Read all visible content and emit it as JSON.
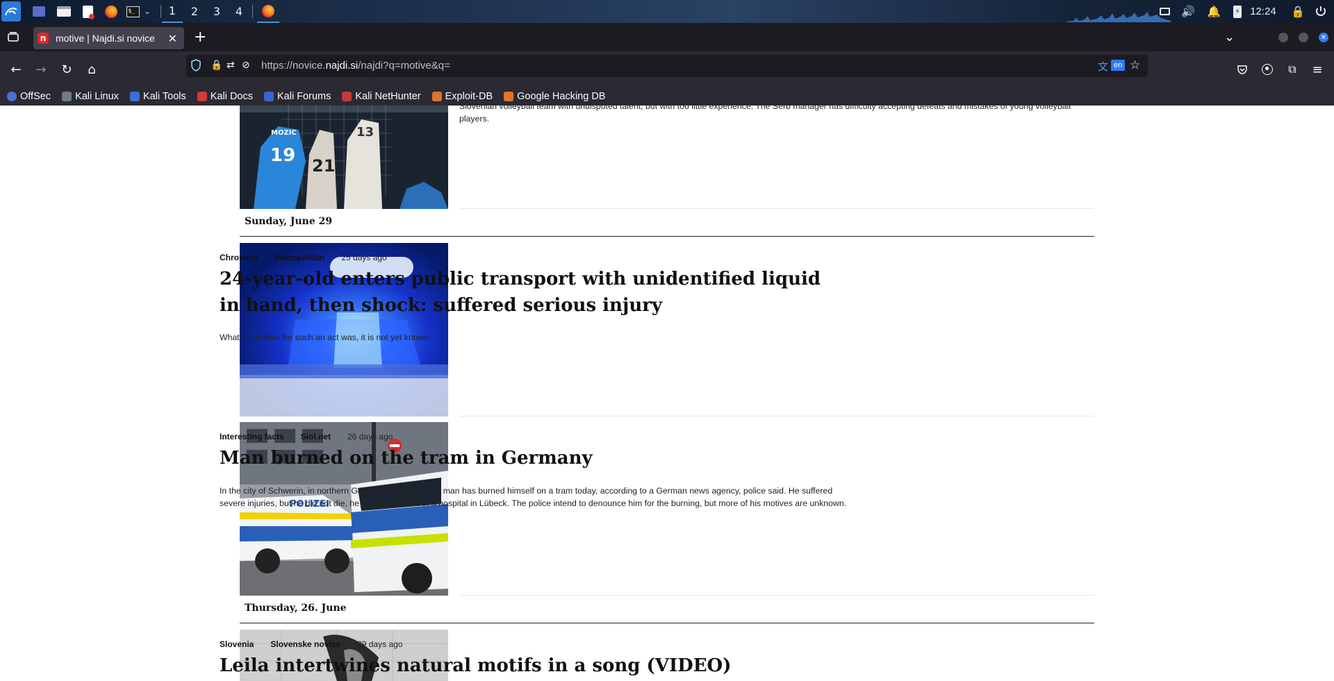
{
  "taskbar": {
    "workspaces": [
      "1",
      "2",
      "3",
      "4"
    ],
    "clock": "12:24"
  },
  "browser": {
    "tab_title": "motive | Najdi.si novice",
    "url_prefix": "https://novice.",
    "url_domain": "najdi.si",
    "url_path": "/najdi?q=motive&q=",
    "translate_badge": "en",
    "bookmarks": [
      "OffSec",
      "Kali Linux",
      "Kali Tools",
      "Kali Docs",
      "Kali Forums",
      "Kali NetHunter",
      "Exploit-DB",
      "Google Hacking DB"
    ]
  },
  "results": {
    "partial_top_summary_line1": "Slovenian volleyball team with undisputed talent, but with too little experience. The Serb manager has difficulty accepting defeats and mistakes of young volleyball",
    "partial_top_summary_line2": "players.",
    "day1": "Sunday, June 29",
    "day2": "Thursday, 26. June",
    "articles": [
      {
        "category": "Chronicle",
        "source": "Metropolitan",
        "age": "25 days ago",
        "title": "24-year-old enters public transport with unidentified liquid in hand, then shock: suffered serious injury",
        "summary": "What his motive for such an act was, it is not yet known."
      },
      {
        "category": "Interesting facts",
        "source": "Siol.net",
        "age": "26 days ago",
        "title": "Man burned on the tram in Germany",
        "summary": "In the city of Schwerin, in northern Germany, a 24-year-old man has burned himself on a tram today, according to a German news agency, police said. He suffered severe injuries, but he did not die, he is being treated in a hospital in Lübeck. The police intend to denounce him for the burning, but more of his motives are unknown."
      },
      {
        "category": "Slovenia",
        "source": "Slovenske novice",
        "age": "29 days ago",
        "title": "Leila intertwines natural motifs in a song (VIDEO)",
        "summary": ""
      }
    ]
  }
}
